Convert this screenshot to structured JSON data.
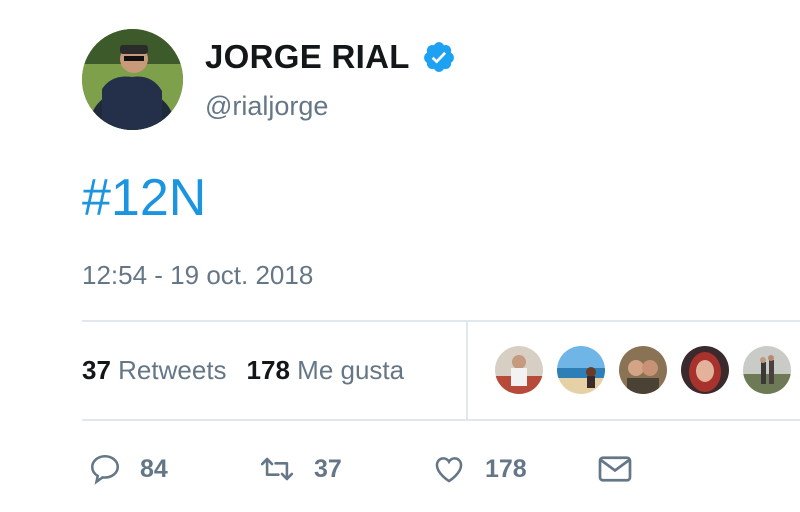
{
  "user": {
    "display_name": "JORGE RIAL",
    "handle": "@rialjorge",
    "verified": true,
    "avatar_icon": "user-avatar-photo"
  },
  "tweet": {
    "text": "#12N",
    "timestamp": "12:54 - 19 oct. 2018"
  },
  "stats": {
    "retweets": {
      "count": "37",
      "label": "Retweets"
    },
    "likes": {
      "count": "178",
      "label": "Me gusta"
    }
  },
  "likers": [
    {
      "icon": "liker-avatar-1"
    },
    {
      "icon": "liker-avatar-2"
    },
    {
      "icon": "liker-avatar-3"
    },
    {
      "icon": "liker-avatar-4"
    },
    {
      "icon": "liker-avatar-5"
    }
  ],
  "actions": {
    "reply": {
      "icon": "reply-icon",
      "count": "84"
    },
    "retweet": {
      "icon": "retweet-icon",
      "count": "37"
    },
    "like": {
      "icon": "heart-icon",
      "count": "178"
    },
    "dm": {
      "icon": "envelope-icon"
    }
  },
  "colors": {
    "link": "#1b95e0",
    "secondary_text": "#657786",
    "divider": "#e1e8ed",
    "verified_badge": "#1da1f2"
  }
}
